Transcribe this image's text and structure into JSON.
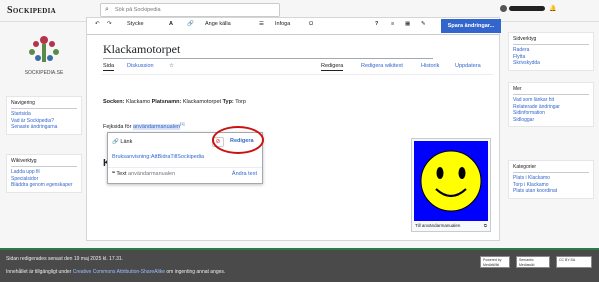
{
  "site": {
    "name": "Sockipedia",
    "logo_caption": "SOCKIPEDIA.SE"
  },
  "search": {
    "placeholder": "Sök på Sockipedia"
  },
  "toolbar": {
    "undo": "↶",
    "redo": "↷",
    "paragraph": "Stycke",
    "textstyle": "A",
    "link": "🔗",
    "cite": "Ange källa",
    "insert": "Infoga",
    "special": "Ω",
    "help": "?",
    "menu": "≡",
    "notice": "▦",
    "pencil": "✎",
    "save": "Spara ändringar..."
  },
  "page": {
    "title": "Klackamotorpet",
    "tabs": [
      "Sida",
      "Diskussion",
      "☆",
      "Redigera",
      "Redigera wikitext",
      "Historik",
      "Uppdatera"
    ],
    "info": {
      "socken_label": "Socken:",
      "socken": "Klackamo",
      "platsnamn_label": "Platsnamn:",
      "platsnamn": "Klackamotorpet",
      "typ_label": "Typ:",
      "typ": "Torp"
    },
    "spel_prefix": "Fejksida för",
    "spel_link": "användarmanualen",
    "spel_sup": "[1]",
    "k_char": "K"
  },
  "link_popup": {
    "label": "Länk",
    "target": "Bruksanvisning:AttBidraTillSockipedia",
    "edit": "Redigera",
    "text_label": "Text",
    "text_value": "användarmanualen",
    "edit_text": "Ändra text"
  },
  "thumb": {
    "caption": "Till användarmanualen",
    "color": "#0000ff"
  },
  "left": {
    "nav_title": "Navigering",
    "nav_items": [
      "Startsida",
      "Vad är Sockipedia?",
      "Senaste ändringarna"
    ],
    "tools_title": "Wikiverktyg",
    "tools_items": [
      "Ladda upp fil",
      "Specialsidor",
      "Bläddra genom egenskaper"
    ]
  },
  "right": {
    "page_tools_title": "Sidverktyg",
    "page_tools": [
      "Radera",
      "Flytta",
      "Skrivskydda"
    ],
    "more_title": "Mer",
    "more_items": [
      "Vad som länkar hit",
      "Relaterade ändringar",
      "Sidinformation",
      "Sidloggar"
    ],
    "cat_title": "Kategorier",
    "cat_items": [
      "Plats i Klackamo",
      "Torp i Klackamo",
      "Plats utan koordinat"
    ]
  },
  "footer": {
    "edited": "Sidan redigerades senast den 19 maj 2025 kl. 17.31.",
    "license_prefix": "Innehållet är tillgängligt under",
    "license_link": "Creative Commons Attribution-ShareAlike",
    "license_suffix": "om ingenting annat anges.",
    "badge1": "Powered by MediaWiki",
    "badge2": "Semantic Mediawiki",
    "badge3": "CC BY-SA"
  },
  "colors": {
    "accent": "#3366cc",
    "highlight_circle": "#cc1111",
    "footer_bg": "#4a4a4a"
  }
}
